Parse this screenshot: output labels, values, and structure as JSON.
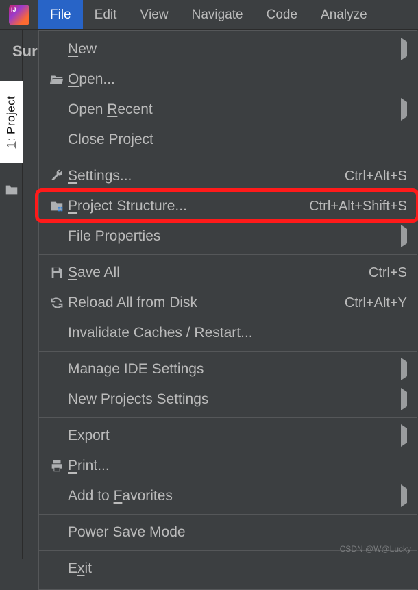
{
  "menubar": {
    "items": [
      {
        "label": "File",
        "mnemonic_index": 0,
        "active": true
      },
      {
        "label": "Edit",
        "mnemonic_index": 0
      },
      {
        "label": "View",
        "mnemonic_index": 0
      },
      {
        "label": "Navigate",
        "mnemonic_index": 0
      },
      {
        "label": "Code",
        "mnemonic_index": 0
      },
      {
        "label": "Analyze",
        "mnemonic_index": 6
      }
    ]
  },
  "left_strip": {
    "project_tab": "1: Project"
  },
  "truncated_header": "Sur",
  "dropdown": {
    "items": [
      {
        "label": "New",
        "mnemonic_index": 0,
        "icon": null,
        "submenu": true
      },
      {
        "label": "Open...",
        "mnemonic_index": 0,
        "icon": "folder-open-icon"
      },
      {
        "label": "Open Recent",
        "mnemonic_index": 5,
        "icon": null,
        "submenu": true
      },
      {
        "label": "Close Project",
        "icon": null
      },
      {
        "sep": true
      },
      {
        "label": "Settings...",
        "mnemonic_index": 0,
        "icon": "wrench-icon",
        "shortcut": "Ctrl+Alt+S"
      },
      {
        "label": "Project Structure...",
        "mnemonic_index": 0,
        "icon": "project-structure-icon",
        "shortcut": "Ctrl+Alt+Shift+S",
        "highlighted": true
      },
      {
        "label": "File Properties",
        "icon": null,
        "submenu": true
      },
      {
        "sep": true
      },
      {
        "label": "Save All",
        "mnemonic_index": 0,
        "icon": "save-icon",
        "shortcut": "Ctrl+S"
      },
      {
        "label": "Reload All from Disk",
        "icon": "reload-icon",
        "shortcut": "Ctrl+Alt+Y"
      },
      {
        "label": "Invalidate Caches / Restart...",
        "icon": null
      },
      {
        "sep": true
      },
      {
        "label": "Manage IDE Settings",
        "icon": null,
        "submenu": true
      },
      {
        "label": "New Projects Settings",
        "icon": null,
        "submenu": true
      },
      {
        "sep": true
      },
      {
        "label": "Export",
        "icon": null,
        "submenu": true
      },
      {
        "label": "Print...",
        "mnemonic_index": 0,
        "icon": "print-icon"
      },
      {
        "label": "Add to Favorites",
        "mnemonic_index": 7,
        "icon": null,
        "submenu": true
      },
      {
        "sep": true
      },
      {
        "label": "Power Save Mode",
        "icon": null
      },
      {
        "sep": true
      },
      {
        "label": "Exit",
        "mnemonic_index": 1,
        "icon": null
      }
    ]
  },
  "watermark": "CSDN @W@Lucky"
}
